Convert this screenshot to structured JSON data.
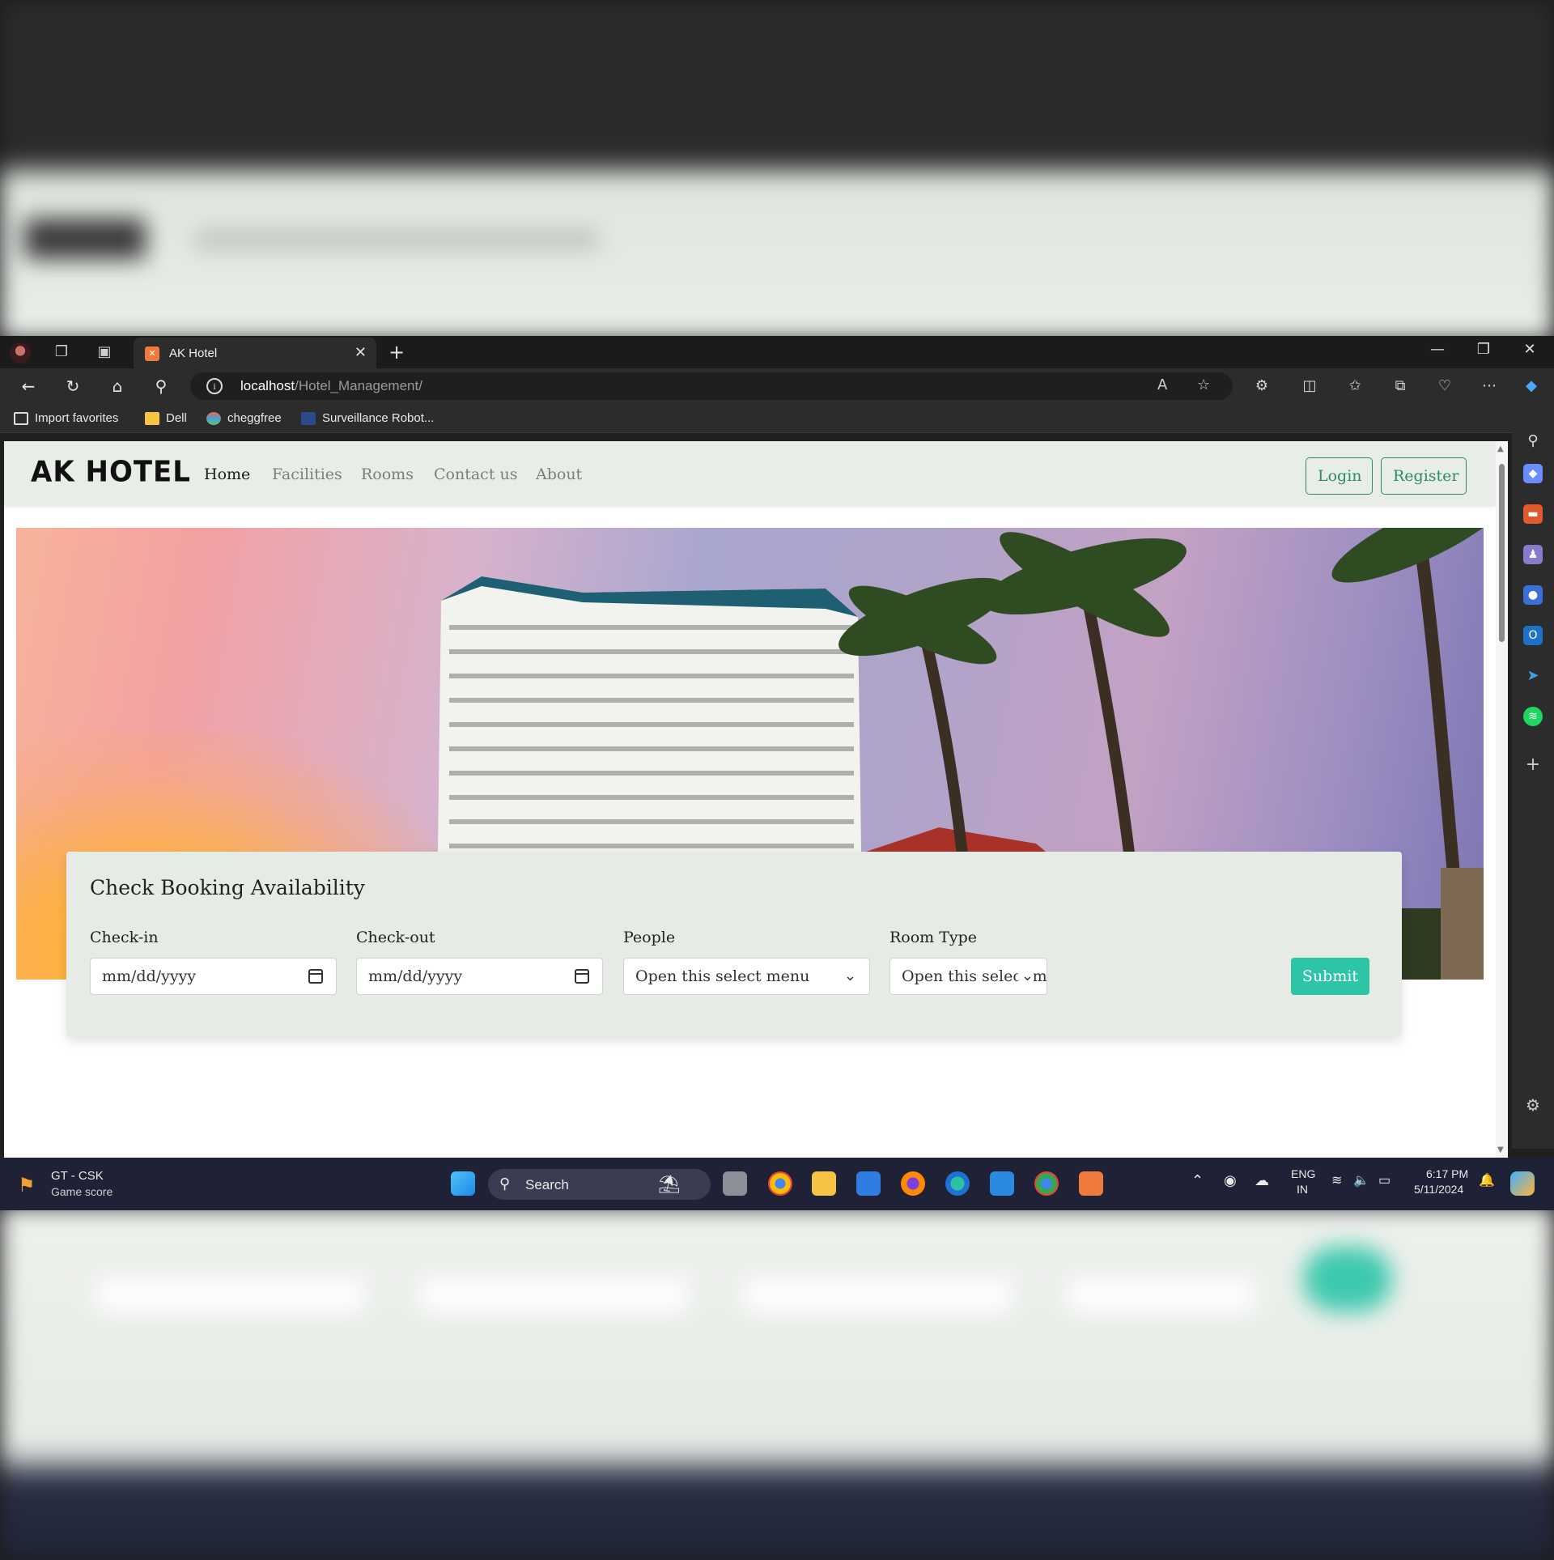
{
  "browser": {
    "tab_title": "AK Hotel",
    "url_host": "localhost",
    "url_path": "/Hotel_Management/",
    "bookmarks": [
      {
        "label": "Import favorites",
        "icon": "import-icon"
      },
      {
        "label": "Dell",
        "icon": "folder-icon"
      },
      {
        "label": "cheggfree",
        "icon": "cheggfree-icon"
      },
      {
        "label": "Surveillance Robot...",
        "icon": "ieee-icon"
      }
    ]
  },
  "site": {
    "brand": "AK HOTEL",
    "nav": [
      "Home",
      "Facilities",
      "Rooms",
      "Contact us",
      "About"
    ],
    "active_nav": "Home",
    "login_label": "Login",
    "register_label": "Register",
    "accent_color": "#2c8a6b",
    "submit_color": "#2ec5a6"
  },
  "booking": {
    "title": "Check Booking Availability",
    "checkin_label": "Check-in",
    "checkin_placeholder": "mm/dd/yyyy",
    "checkout_label": "Check-out",
    "checkout_placeholder": "mm/dd/yyyy",
    "people_label": "People",
    "people_value": "Open this select menu",
    "roomtype_label": "Room Type",
    "roomtype_value": "Open this select me",
    "submit_label": "Submit"
  },
  "taskbar": {
    "widget_title": "GT - CSK",
    "widget_subtitle": "Game score",
    "search_label": "Search",
    "lang_top": "ENG",
    "lang_bottom": "IN",
    "time": "6:17 PM",
    "date": "5/11/2024"
  }
}
